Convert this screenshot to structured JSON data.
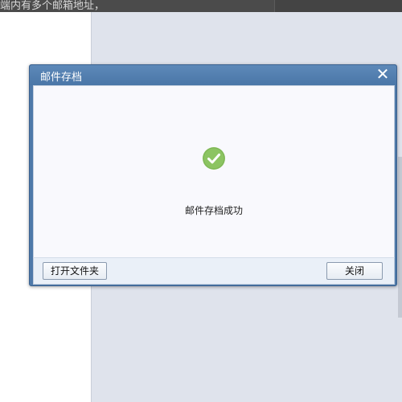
{
  "background": {
    "top_bar_text": "端内有多个邮箱地址，"
  },
  "dialog": {
    "title": "邮件存档",
    "close_glyph": "✕",
    "message": "邮件存档成功",
    "open_folder_label": "打开文件夹",
    "close_label": "关闭"
  },
  "colors": {
    "accent": "#4e79a9",
    "success": "#8cc462"
  },
  "icons": {
    "status": "check-circle-icon",
    "close": "close-icon"
  }
}
